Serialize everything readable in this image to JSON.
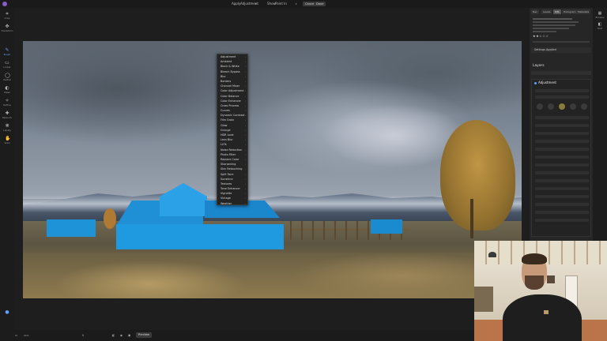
{
  "topbar": {
    "apply_label": "Apply",
    "apply_value": "Adjustment",
    "show_label": "Show",
    "show_value": "Paint In",
    "cancel_label": "Cancel",
    "done_label": "Done"
  },
  "tools": [
    {
      "icon": "crop-icon",
      "label": "Crop"
    },
    {
      "icon": "transform-icon",
      "label": "Transform"
    },
    {
      "icon": "brush-icon",
      "label": "Brush"
    },
    {
      "icon": "linear-mask-icon",
      "label": "Linear"
    },
    {
      "icon": "radial-mask-icon",
      "label": "Radial"
    },
    {
      "icon": "mask-icon",
      "label": "Mask"
    },
    {
      "icon": "refine-icon",
      "label": "Refine"
    },
    {
      "icon": "retouch-icon",
      "label": "Retouch"
    },
    {
      "icon": "liquify-icon",
      "label": "Liquify"
    },
    {
      "icon": "view-icon",
      "label": "View"
    }
  ],
  "menu": {
    "items": [
      "Adjustment",
      "Ambient",
      "Black & White",
      "Bleach Bypass",
      "Blur",
      "Borders",
      "Channel Mixer",
      "Color Adjustment",
      "Color Balance",
      "Color Enhancer",
      "Cross Process",
      "Curves",
      "Dynamic Contrast",
      "Film Grain",
      "Glow",
      "Grunge",
      "HDR Look",
      "Lens Blur",
      "LUTs",
      "Noise Reduction",
      "Photo Filter",
      "Replace Color",
      "Sharpening",
      "Skin Retouching",
      "Split Tone",
      "Sunshine",
      "Textures",
      "Tone Enhancer",
      "Vignette",
      "Vintage",
      "Weather"
    ]
  },
  "right_panel": {
    "tabs": [
      "Nav",
      "Levels",
      "Info",
      "Histogram",
      "Metadata"
    ],
    "active_tab": "Info",
    "rating": "★★☆☆☆",
    "section_settings": "Settings Applied",
    "layers_title": "Layers",
    "adjustment_title": "Adjustment"
  },
  "far_strip": [
    {
      "icon": "browse-icon",
      "label": "Browse"
    },
    {
      "icon": "edit-icon",
      "label": "Edit"
    }
  ],
  "bottombar": {
    "zoom_value": "0",
    "preview_label": "Preview"
  },
  "colors": {
    "accent": "#5aa3ff",
    "mask": "#1f9ae0",
    "panel_bg": "#262626"
  }
}
